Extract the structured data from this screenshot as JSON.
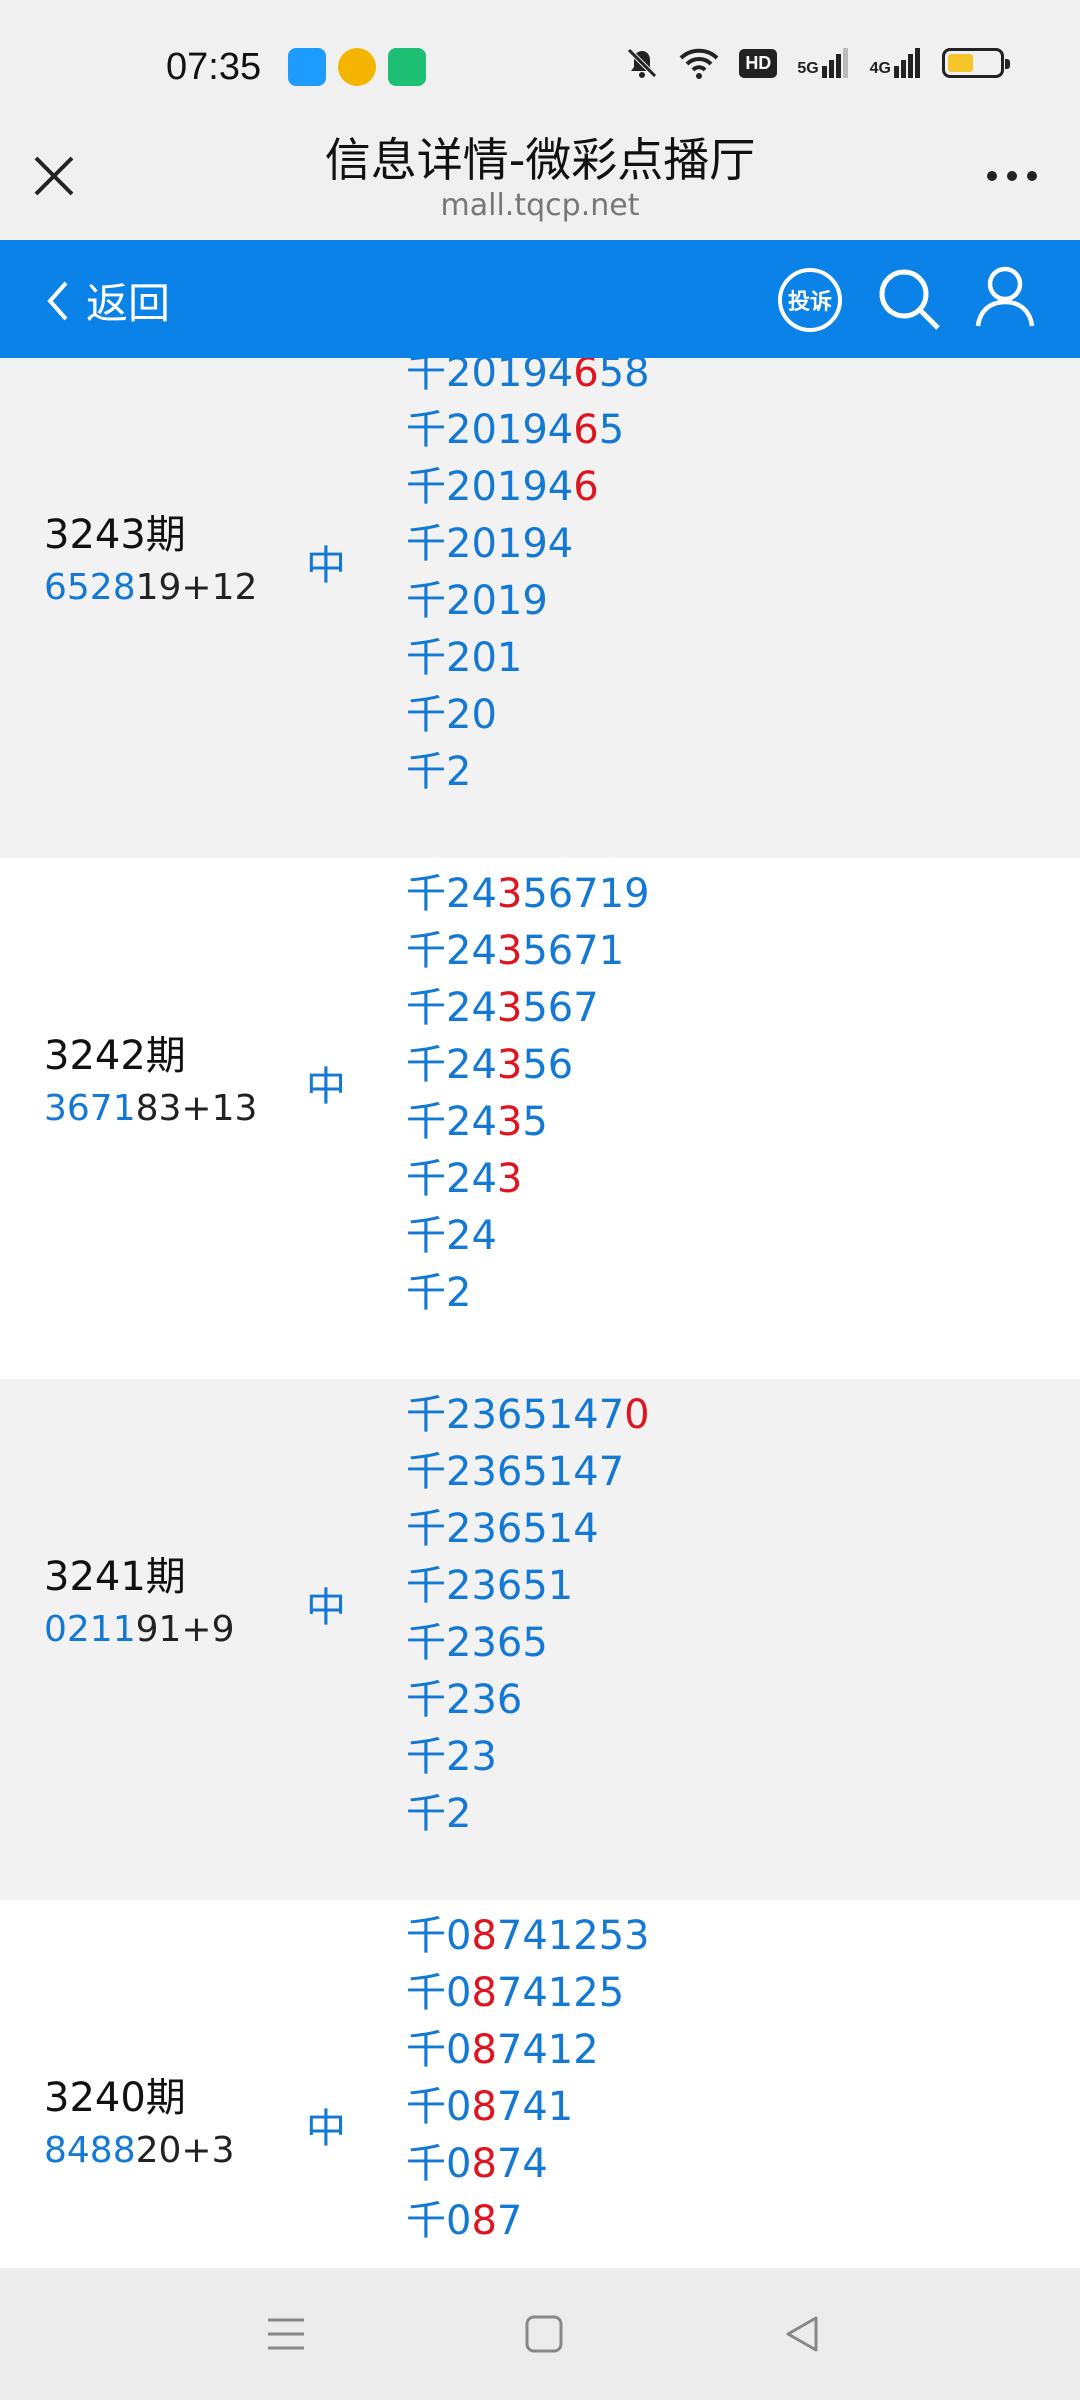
{
  "status": {
    "time": "07:35",
    "hd_badge": "HD",
    "sig1_label": "5G",
    "sig2_label": "4G",
    "battery_level": 0.5,
    "battery_color": "#f6c52b"
  },
  "browser": {
    "title": "信息详情-微彩点播厅",
    "url": "mall.tqcp.net"
  },
  "nav": {
    "back_label": "返回",
    "report_label": "投诉",
    "accent": "#0a82e8"
  },
  "rows": [
    {
      "period": "3243期",
      "nums_blue": "6528",
      "nums_rest": "19+12",
      "hit": "中",
      "preds": [
        [
          [
            "千20194",
            0
          ],
          [
            "6",
            1
          ],
          [
            "58",
            0
          ]
        ],
        [
          [
            "千20194",
            0
          ],
          [
            "6",
            1
          ],
          [
            "5",
            0
          ]
        ],
        [
          [
            "千20194",
            0
          ],
          [
            "6",
            1
          ]
        ],
        [
          [
            "千20194",
            0
          ]
        ],
        [
          [
            "千2019",
            0
          ]
        ],
        [
          [
            "千201",
            0
          ]
        ],
        [
          [
            "千20",
            0
          ]
        ],
        [
          [
            "千2",
            0
          ]
        ]
      ]
    },
    {
      "period": "3242期",
      "nums_blue": "3671",
      "nums_rest": "83+13",
      "hit": "中",
      "preds": [
        [
          [
            "千24",
            0
          ],
          [
            "3",
            1
          ],
          [
            "56719",
            0
          ]
        ],
        [
          [
            "千24",
            0
          ],
          [
            "3",
            1
          ],
          [
            "5671",
            0
          ]
        ],
        [
          [
            "千24",
            0
          ],
          [
            "3",
            1
          ],
          [
            "567",
            0
          ]
        ],
        [
          [
            "千24",
            0
          ],
          [
            "3",
            1
          ],
          [
            "56",
            0
          ]
        ],
        [
          [
            "千24",
            0
          ],
          [
            "3",
            1
          ],
          [
            "5",
            0
          ]
        ],
        [
          [
            "千24",
            0
          ],
          [
            "3",
            1
          ]
        ],
        [
          [
            "千24",
            0
          ]
        ],
        [
          [
            "千2",
            0
          ]
        ]
      ]
    },
    {
      "period": "3241期",
      "nums_blue": "0211",
      "nums_rest": "91+9",
      "hit": "中",
      "preds": [
        [
          [
            "千2365147",
            0
          ],
          [
            "0",
            1
          ]
        ],
        [
          [
            "千2365147",
            0
          ]
        ],
        [
          [
            "千236514",
            0
          ]
        ],
        [
          [
            "千23651",
            0
          ]
        ],
        [
          [
            "千2365",
            0
          ]
        ],
        [
          [
            "千236",
            0
          ]
        ],
        [
          [
            "千23",
            0
          ]
        ],
        [
          [
            "千2",
            0
          ]
        ]
      ]
    },
    {
      "period": "3240期",
      "nums_blue": "8488",
      "nums_rest": "20+3",
      "hit": "中",
      "preds": [
        [
          [
            "千0",
            0
          ],
          [
            "8",
            1
          ],
          [
            "741253",
            0
          ]
        ],
        [
          [
            "千0",
            0
          ],
          [
            "8",
            1
          ],
          [
            "74125",
            0
          ]
        ],
        [
          [
            "千0",
            0
          ],
          [
            "8",
            1
          ],
          [
            "7412",
            0
          ]
        ],
        [
          [
            "千0",
            0
          ],
          [
            "8",
            1
          ],
          [
            "741",
            0
          ]
        ],
        [
          [
            "千0",
            0
          ],
          [
            "8",
            1
          ],
          [
            "74",
            0
          ]
        ],
        [
          [
            "千0",
            0
          ],
          [
            "8",
            1
          ],
          [
            "7",
            0
          ]
        ]
      ]
    }
  ]
}
